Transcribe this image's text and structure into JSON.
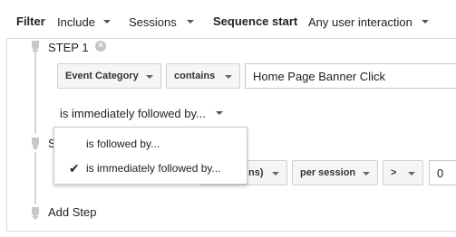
{
  "filter_bar": {
    "filter_label": "Filter",
    "include_value": "Include",
    "sessions_value": "Sessions",
    "sequence_start_label": "Sequence start",
    "sequence_start_value": "Any user interaction"
  },
  "step1": {
    "label": "STEP 1",
    "dimension": "Event Category",
    "operator": "contains",
    "value": "Home Page Banner Click",
    "follow_rule": "is immediately followed by..."
  },
  "step2": {
    "label_partial": "S",
    "dimension_partial": "ns)",
    "scope": "per session",
    "comparator": ">",
    "value": "0"
  },
  "add_step_label": "Add Step",
  "follow_menu": {
    "options": [
      {
        "label": "is followed by...",
        "checked": false
      },
      {
        "label": "is immediately followed by...",
        "checked": true
      }
    ],
    "check_glyph": "✔"
  },
  "icons": {
    "close": "close-circle-icon",
    "caret": "caret-down-icon",
    "check": "checkmark-icon",
    "step_marker": "step-marker-icon"
  }
}
